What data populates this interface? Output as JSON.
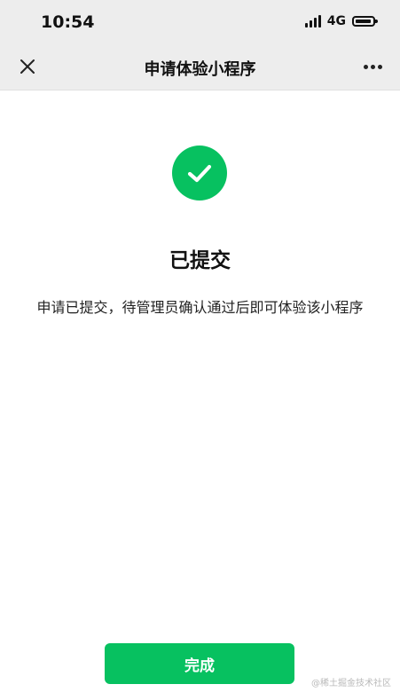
{
  "status_bar": {
    "time": "10:54",
    "network": "4G",
    "icons": [
      "signal-icon",
      "battery-icon"
    ]
  },
  "nav": {
    "title": "申请体验小程序",
    "close_icon": "close-icon",
    "more_icon": "more-icon"
  },
  "result": {
    "icon": "check-circle-icon",
    "title": "已提交",
    "description": "申请已提交，待管理员确认通过后即可体验该小程序"
  },
  "actions": {
    "done_label": "完成"
  },
  "watermark": {
    "text": "@稀土掘金技术社区"
  },
  "colors": {
    "accent": "#07c160",
    "bar_background": "#ededed",
    "page_background": "#ffffff"
  }
}
